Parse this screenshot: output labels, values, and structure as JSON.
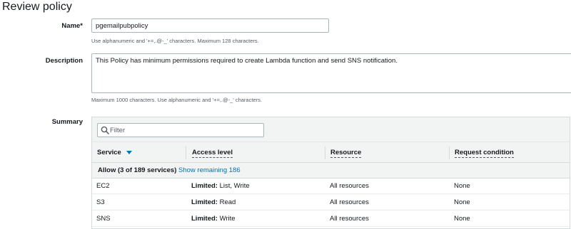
{
  "page": {
    "title": "Review policy"
  },
  "name_field": {
    "label": "Name*",
    "value": "pgemailpubpolicy",
    "hint": "Use alphanumeric and '+=,.@-_' characters. Maximum 128 characters."
  },
  "description_field": {
    "label": "Description",
    "value": "This Policy has minimum permissions required to create Lambda function and send SNS notification.",
    "hint": "Maximum 1000 characters. Use alphanumeric and '+=,.@-_' characters."
  },
  "summary": {
    "label": "Summary",
    "filter_placeholder": "Filter",
    "columns": {
      "service": "Service",
      "access_level": "Access level",
      "resource": "Resource",
      "request_condition": "Request condition"
    },
    "group": {
      "label": "Allow (3 of 189 services)",
      "show_remaining": "Show remaining 186"
    },
    "rows": [
      {
        "service": "EC2",
        "access_bold": "Limited:",
        "access_rest": " List, Write",
        "resource": "All resources",
        "condition": "None"
      },
      {
        "service": "S3",
        "access_bold": "Limited:",
        "access_rest": " Read",
        "resource": "All resources",
        "condition": "None"
      },
      {
        "service": "SNS",
        "access_bold": "Limited:",
        "access_rest": " Write",
        "resource": "All resources",
        "condition": "None"
      }
    ]
  },
  "colors": {
    "link": "#0073bb",
    "header_bg": "#f2f3f3",
    "border": "#aab7b8"
  },
  "icons": {
    "filter": "search-icon",
    "sort": "caret-down-icon"
  }
}
